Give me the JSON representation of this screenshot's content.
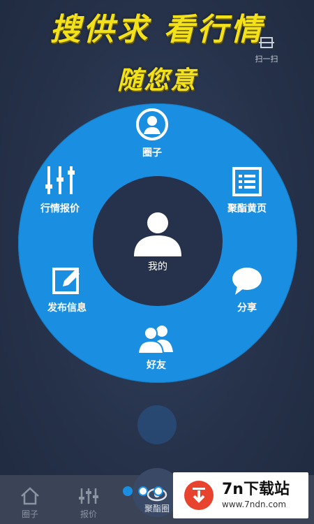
{
  "header": {
    "slogan_line1": "搜供求 看行情",
    "slogan_line2": "随您意",
    "scan_label": "扫一扫"
  },
  "menu": {
    "center_label": "我的",
    "items": [
      {
        "label": "圈子",
        "icon": "person-circle-icon"
      },
      {
        "label": "聚酯黄页",
        "icon": "list-doc-icon"
      },
      {
        "label": "分享",
        "icon": "chat-bubble-icon"
      },
      {
        "label": "好友",
        "icon": "friends-icon"
      },
      {
        "label": "发布信息",
        "icon": "edit-icon"
      },
      {
        "label": "行情报价",
        "icon": "sliders-icon"
      }
    ]
  },
  "bottom_nav": {
    "tabs": [
      {
        "label": "圈子",
        "icon": "home-icon"
      },
      {
        "label": "报价",
        "icon": "sliders-icon"
      },
      {
        "label": "聚酯圈",
        "icon": "eye-icon"
      }
    ]
  },
  "pager": {
    "count": 3,
    "active_index": 0
  },
  "watermark": {
    "title": "7n下载站",
    "url": "www.7ndn.com"
  },
  "colors": {
    "accent": "#1a8ee0",
    "slogan": "#f3e11a",
    "background": "#26324a"
  }
}
